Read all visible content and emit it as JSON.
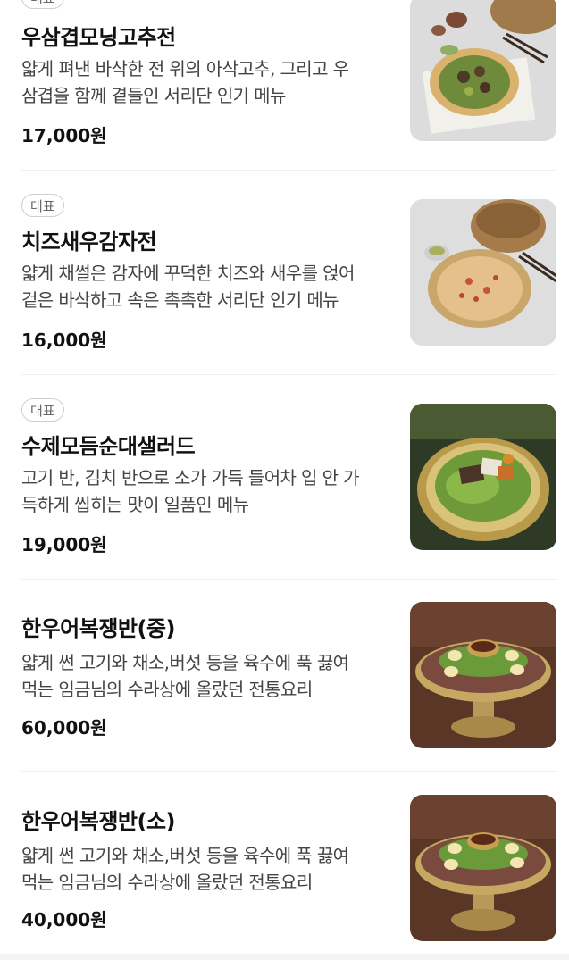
{
  "menu": {
    "items": [
      {
        "badge": "대표",
        "name": "우삼겹모닝고추전",
        "desc_line1": "얇게 펴낸 바삭한 전 위의 아삭고추, 그리고 우",
        "desc_line2": "삼겹을 함께 곁들인 서리단 인기 메뉴",
        "price": "17,000원",
        "image_icon": "pancake-with-peppers-photo"
      },
      {
        "badge": "대표",
        "name": "치즈새우감자전",
        "desc_line1": "얇게 채썰은 감자에 꾸덕한 치즈와 새우를 얹어",
        "desc_line2": "겉은 바삭하고 속은 촉촉한 서리단 인기 메뉴",
        "price": "16,000원",
        "image_icon": "potato-pancake-photo"
      },
      {
        "badge": "대표",
        "name": "수제모듬순대샐러드",
        "desc_line1": "고기 반, 김치 반으로 소가 가득 들어차 입 안 가",
        "desc_line2": "득하게 씹히는 맛이 일품인 메뉴",
        "price": "19,000원",
        "image_icon": "sundae-salad-photo"
      },
      {
        "name": "한우어복쟁반(중)",
        "desc_line1": "얇게 썬 고기와 채소,버섯 등을 육수에 푹 끓여",
        "desc_line2": "먹는 임금님의 수라상에 올랐던 전통요리",
        "price": "60,000원",
        "image_icon": "beef-hotpot-photo"
      },
      {
        "name": "한우어복쟁반(소)",
        "desc_line1": "얇게 썬 고기와 채소,버섯 등을 육수에 푹 끓여",
        "desc_line2": "먹는 임금님의 수라상에 올랐던 전통요리",
        "price": "40,000원",
        "image_icon": "beef-hotpot-photo"
      }
    ]
  }
}
